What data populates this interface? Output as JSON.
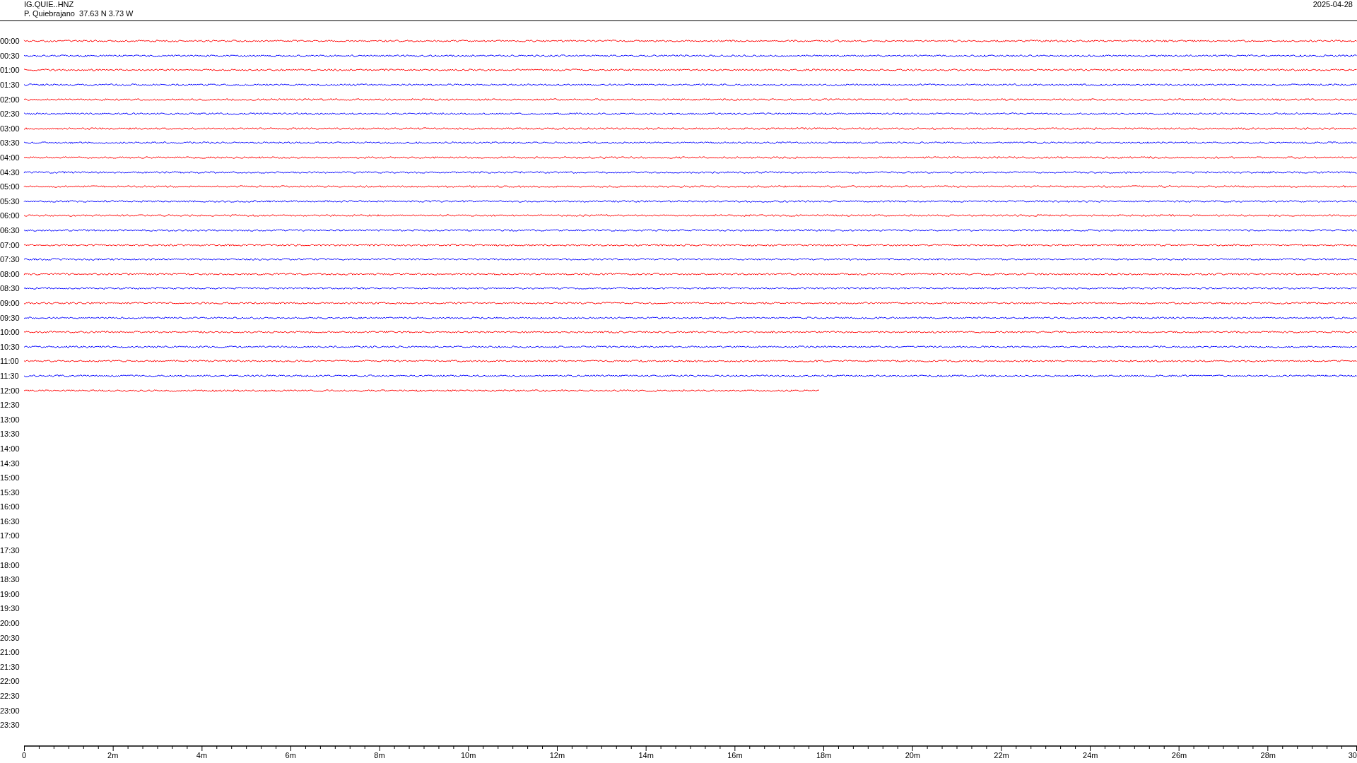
{
  "header": {
    "station": "IG.QUIE..HNZ",
    "location": "P. Quiebrajano  37.63 N 3.73 W",
    "date": "2025-04-28"
  },
  "rows": [
    {
      "label": "00:00",
      "level": 1,
      "color": "#ff0000"
    },
    {
      "label": "00:30",
      "level": 1,
      "color": "#0000ff"
    },
    {
      "label": "01:00",
      "level": 1,
      "color": "#ff0000"
    },
    {
      "label": "01:30",
      "level": 1,
      "color": "#0000ff"
    },
    {
      "label": "02:00",
      "level": 1,
      "color": "#ff0000"
    },
    {
      "label": "02:30",
      "level": 1,
      "color": "#0000ff"
    },
    {
      "label": "03:00",
      "level": 1,
      "color": "#ff0000"
    },
    {
      "label": "03:30",
      "level": 1,
      "color": "#0000ff"
    },
    {
      "label": "04:00",
      "level": 1,
      "color": "#ff0000"
    },
    {
      "label": "04:30",
      "level": 1,
      "color": "#0000ff"
    },
    {
      "label": "05:00",
      "level": 1,
      "color": "#ff0000"
    },
    {
      "label": "05:30",
      "level": 1,
      "color": "#0000ff"
    },
    {
      "label": "06:00",
      "level": 1,
      "color": "#ff0000"
    },
    {
      "label": "06:30",
      "level": 1,
      "color": "#0000ff"
    },
    {
      "label": "07:00",
      "level": 1,
      "color": "#ff0000"
    },
    {
      "label": "07:30",
      "level": 1,
      "color": "#0000ff"
    },
    {
      "label": "08:00",
      "level": 1,
      "color": "#ff0000"
    },
    {
      "label": "08:30",
      "level": 1,
      "color": "#0000ff"
    },
    {
      "label": "09:00",
      "level": 1,
      "color": "#ff0000"
    },
    {
      "label": "09:30",
      "level": 1,
      "color": "#0000ff"
    },
    {
      "label": "10:00",
      "level": 1,
      "color": "#ff0000"
    },
    {
      "label": "10:30",
      "level": 1,
      "color": "#0000ff"
    },
    {
      "label": "11:00",
      "level": 1,
      "color": "#ff0000"
    },
    {
      "label": "11:30",
      "level": 1,
      "color": "#0000ff"
    },
    {
      "label": "12:00",
      "level": 0.597,
      "color": "#ff0000"
    },
    {
      "label": "12:30"
    },
    {
      "label": "13:00"
    },
    {
      "label": "13:30"
    },
    {
      "label": "14:00"
    },
    {
      "label": "14:30"
    },
    {
      "label": "15:00"
    },
    {
      "label": "15:30"
    },
    {
      "label": "16:00"
    },
    {
      "label": "16:30"
    },
    {
      "label": "17:00"
    },
    {
      "label": "17:30"
    },
    {
      "label": "18:00"
    },
    {
      "label": "18:30"
    },
    {
      "label": "19:00"
    },
    {
      "label": "19:30"
    },
    {
      "label": "20:00"
    },
    {
      "label": "20:30"
    },
    {
      "label": "21:00"
    },
    {
      "label": "21:30"
    },
    {
      "label": "22:00"
    },
    {
      "label": "22:30"
    },
    {
      "label": "23:00"
    },
    {
      "label": "23:30"
    }
  ],
  "axis": {
    "labels": [
      "0",
      "2m",
      "4m",
      "6m",
      "8m",
      "10m",
      "12m",
      "14m",
      "16m",
      "18m",
      "20m",
      "22m",
      "24m",
      "26m",
      "28m",
      "30"
    ]
  }
}
